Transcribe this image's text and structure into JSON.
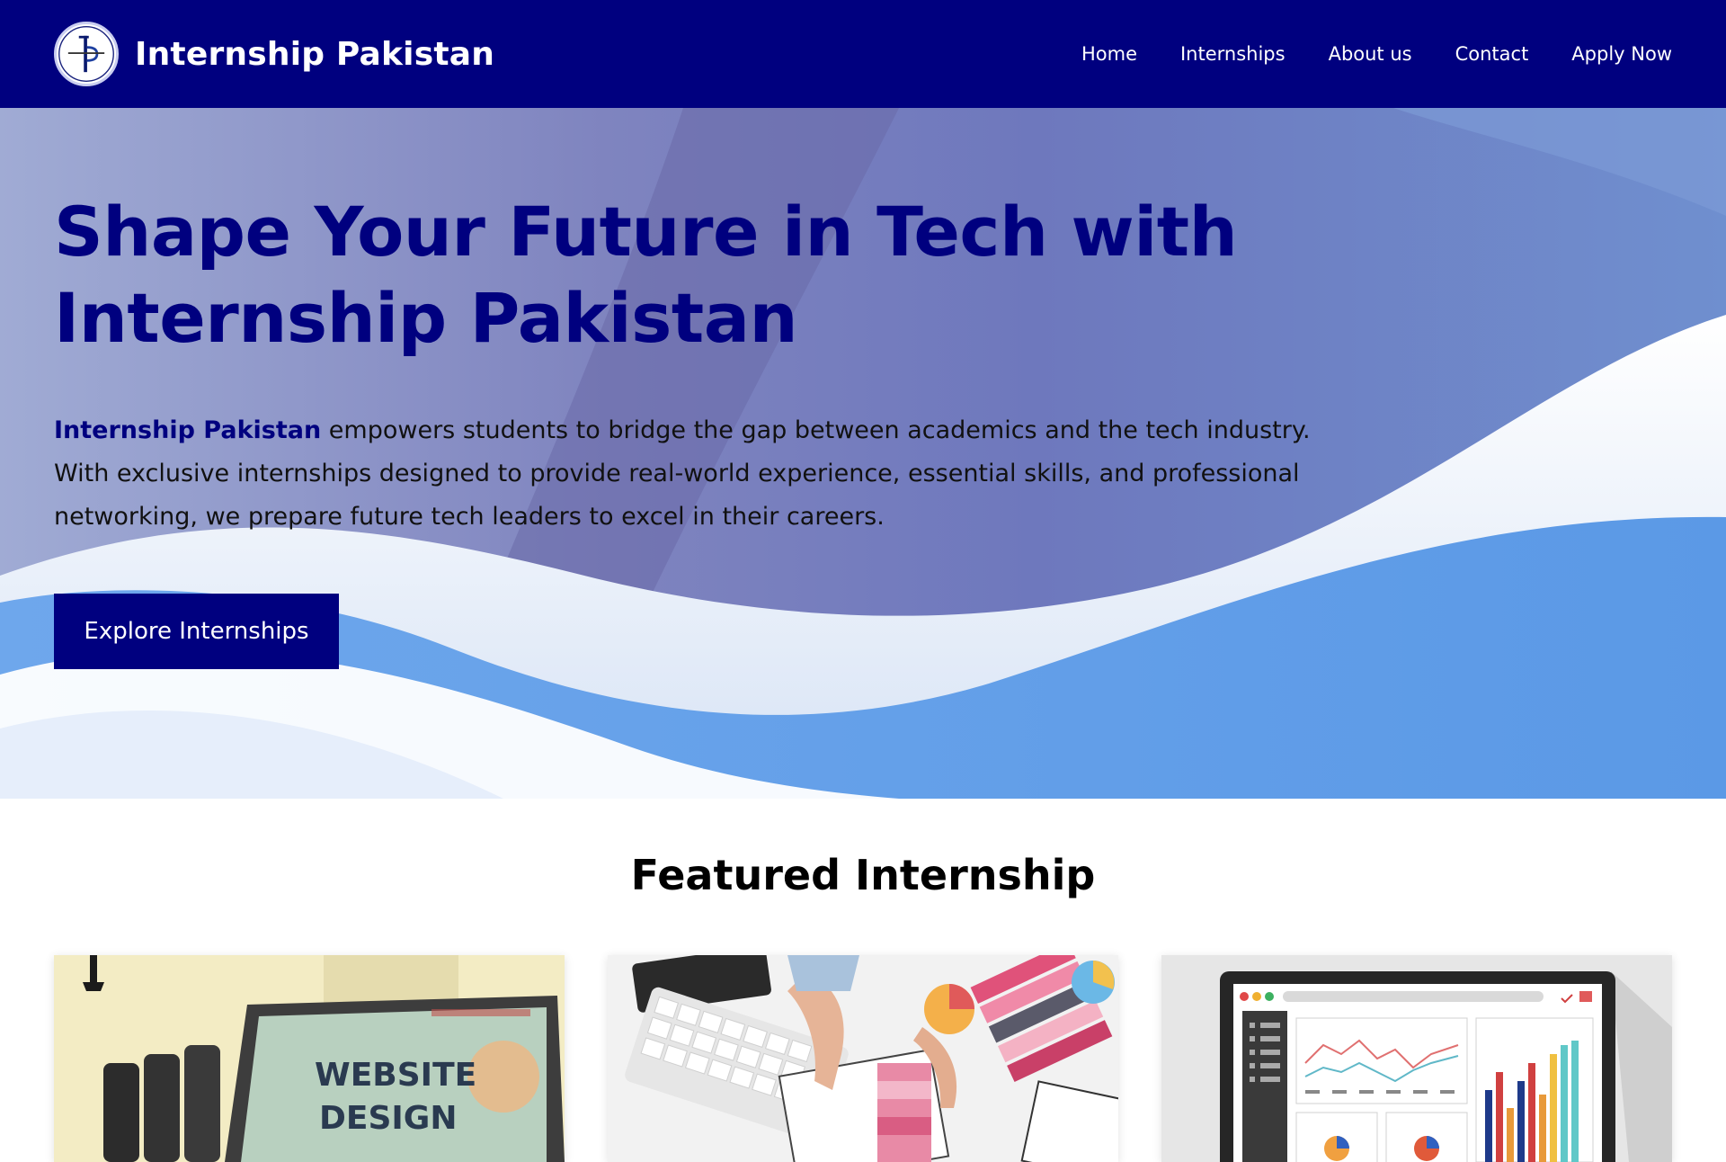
{
  "nav": {
    "brand": "Internship Pakistan",
    "logo_icon": "internship-pakistan-logo-icon",
    "links": [
      {
        "label": "Home"
      },
      {
        "label": "Internships"
      },
      {
        "label": "About us"
      },
      {
        "label": "Contact"
      },
      {
        "label": "Apply Now"
      }
    ]
  },
  "hero": {
    "title": "Shape Your Future in Tech with Internship Pakistan",
    "description_highlight": "Internship Pakistan",
    "description_rest": " empowers students to bridge the gap between academics and the tech industry. With exclusive internships designed to provide real-world experience, essential skills, and professional networking, we prepare future tech leaders to excel in their careers.",
    "cta": "Explore Internships"
  },
  "featured": {
    "title": "Featured Internship",
    "cards": [
      {
        "image": "website-design-laptop-image",
        "image_text_line1": "WEBSITE",
        "image_text_line2": "DESIGN"
      },
      {
        "image": "ui-design-sketch-image"
      },
      {
        "image": "analytics-dashboard-image"
      }
    ]
  },
  "colors": {
    "primary": "#00007f",
    "wave_blue": "#64a0e8",
    "white": "#ffffff"
  }
}
